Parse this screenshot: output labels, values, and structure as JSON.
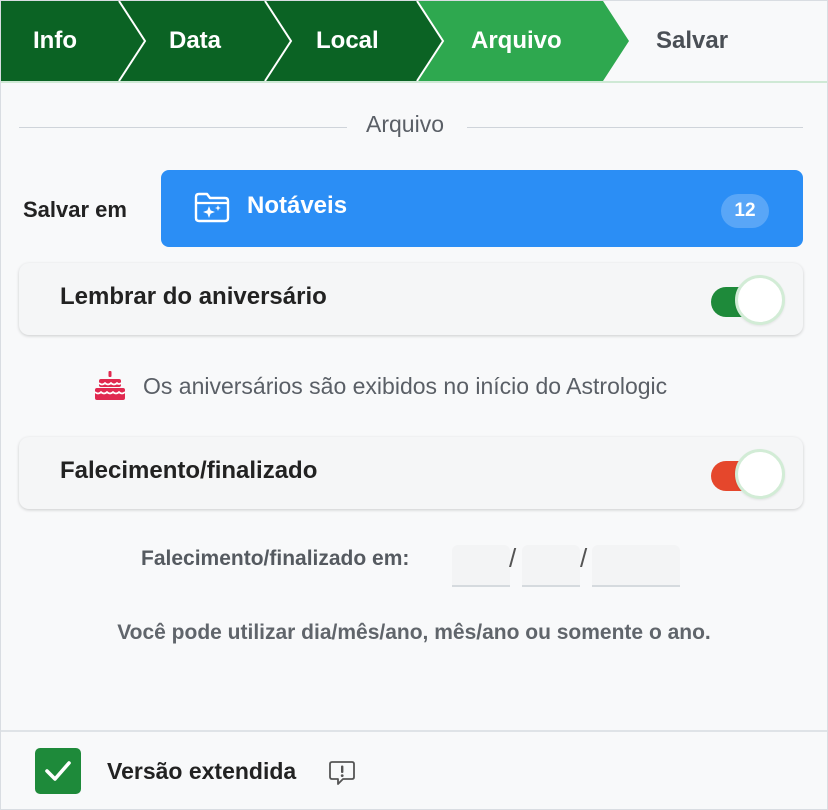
{
  "stepper": {
    "steps": [
      {
        "label": "Info",
        "state": "done"
      },
      {
        "label": "Data",
        "state": "done"
      },
      {
        "label": "Local",
        "state": "done"
      },
      {
        "label": "Arquivo",
        "state": "current"
      },
      {
        "label": "Salvar",
        "state": "upcoming"
      }
    ],
    "colors": {
      "done": "#0b6324",
      "current": "#2ea84f",
      "upcoming": "#f8f9fa"
    }
  },
  "section": {
    "title": "Arquivo"
  },
  "save_in": {
    "label": "Salvar em",
    "folder_icon": "folder-sparkle-icon",
    "folder_name": "Notáveis",
    "count": "12",
    "color": "#2b8ef5"
  },
  "birthday": {
    "label": "Lembrar do aniversário",
    "enabled": true,
    "track_color": "#1e8a3a",
    "info_icon": "cake-icon",
    "info_text": "Os aniversários são exibidos no início do Astrologic"
  },
  "death": {
    "label": "Falecimento/finalizado",
    "enabled": true,
    "track_color": "#e5472c",
    "date_label": "Falecimento/finalizado em:",
    "day": "",
    "month": "",
    "year": "",
    "hint": "Você pode utilizar dia/mês/ano, mês/ano ou somente o ano."
  },
  "footer": {
    "extended_label": "Versão extendida",
    "extended_checked": true,
    "help_icon": "alert-comment-icon"
  }
}
